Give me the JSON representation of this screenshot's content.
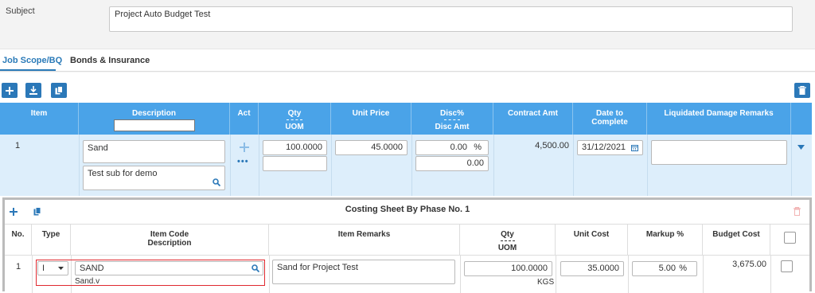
{
  "subject": {
    "label": "Subject",
    "value": "Project Auto Budget Test"
  },
  "tabs": [
    {
      "label": "Job Scope/BQ",
      "active": true
    },
    {
      "label": "Bonds & Insurance",
      "active": false
    }
  ],
  "toolbar": {
    "add_icon": "plus-icon",
    "download_icon": "download-icon",
    "copy_icon": "copy-icon",
    "delete_icon": "trash-icon"
  },
  "colors": {
    "accent": "#2b78b8",
    "header_bg": "#4aa3e8",
    "row_bg": "#ddeefb",
    "highlight_border": "#e0292f"
  },
  "main_table": {
    "headers": {
      "item": "Item",
      "description": "Description",
      "act": "Act",
      "qty": "Qty",
      "uom": "UOM",
      "unit_price": "Unit Price",
      "disc_pct": "Disc%",
      "disc_amt": "Disc Amt",
      "contract_amt": "Contract Amt",
      "date_to_complete_1": "Date to",
      "date_to_complete_2": "Complete",
      "ld_remarks": "Liquidated Damage Remarks"
    },
    "row": {
      "item": "1",
      "description": "Sand",
      "sub_description": "Test sub for demo",
      "act_more": "•••",
      "qty": "100.0000",
      "uom": "",
      "unit_price": "45.0000",
      "disc_pct": "0.00",
      "pct_symbol": "%",
      "disc_amt": "0.00",
      "contract_amt": "4,500.00",
      "date": "31/12/2021",
      "ld_remarks": ""
    }
  },
  "costing_sheet": {
    "title": "Costing Sheet By Phase No. 1",
    "headers": {
      "no": "No.",
      "type": "Type",
      "item_code": "Item Code",
      "description": "Description",
      "item_remarks": "Item Remarks",
      "qty": "Qty",
      "uom": "UOM",
      "unit_cost": "Unit Cost",
      "markup": "Markup %",
      "budget_cost": "Budget Cost"
    },
    "row": {
      "no": "1",
      "type": "I",
      "item_code": "SAND",
      "description": "Sand.v",
      "item_remarks": "Sand for Project Test",
      "qty": "100.0000",
      "uom": "KGS",
      "unit_cost": "35.0000",
      "markup": "5.00",
      "pct_symbol": "%",
      "budget_cost": "3,675.00"
    }
  }
}
